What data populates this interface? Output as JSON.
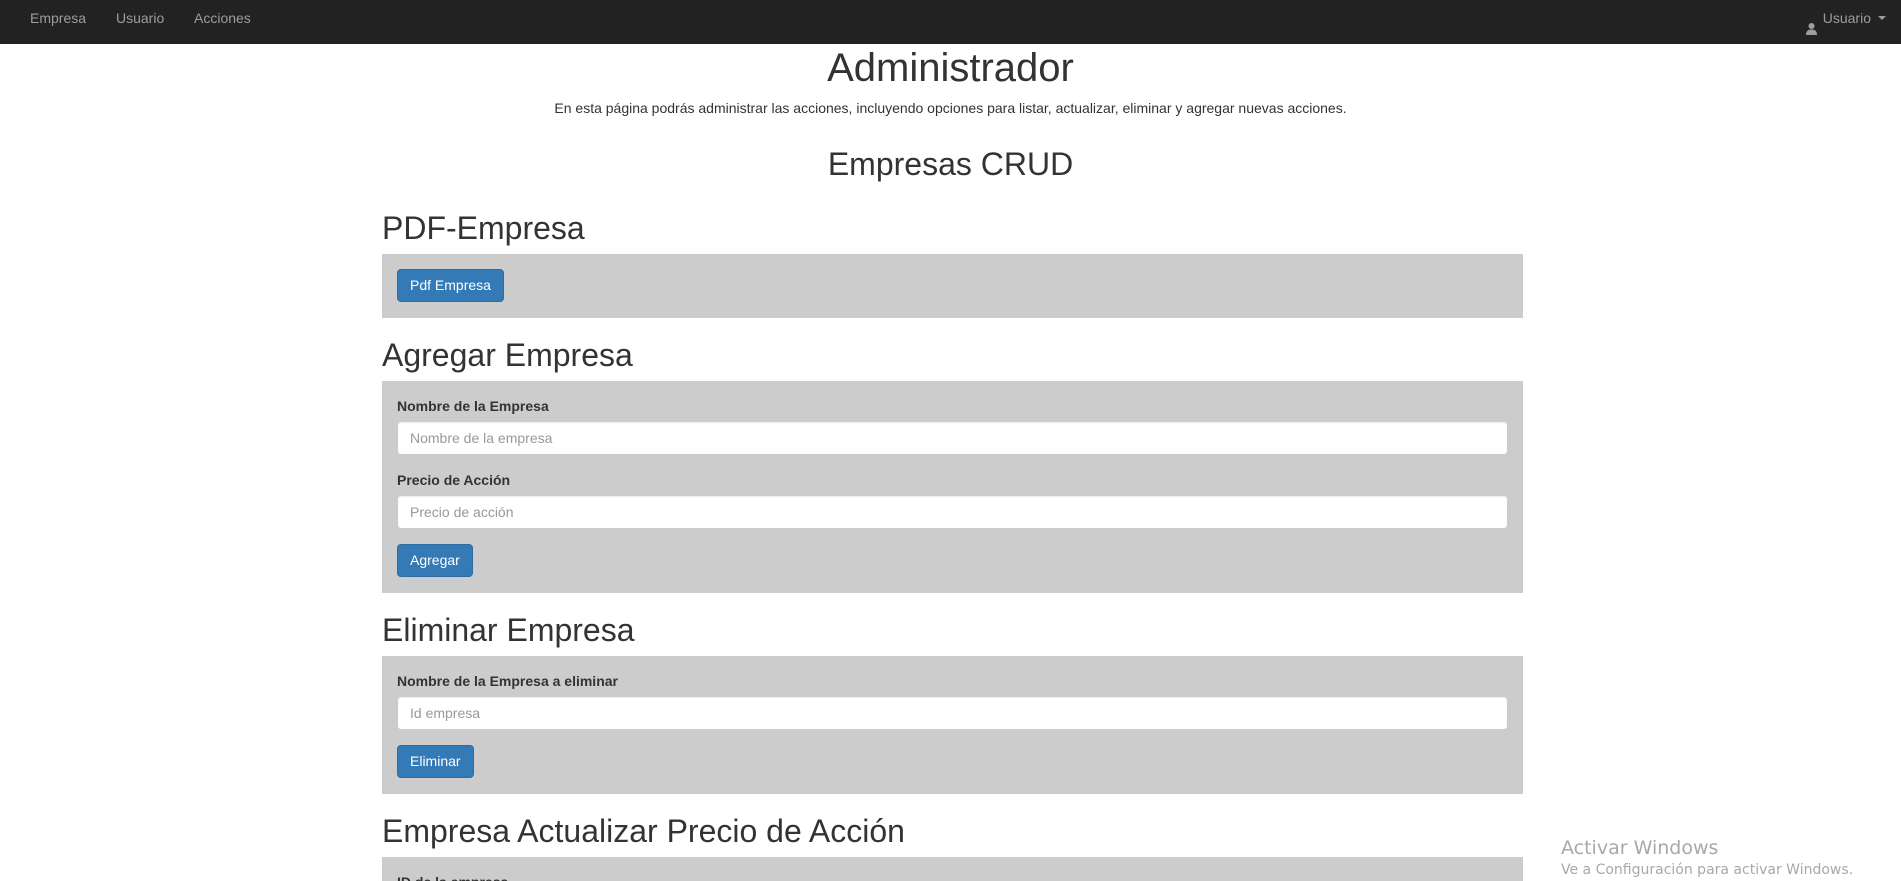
{
  "navbar": {
    "items": [
      {
        "label": "Empresa"
      },
      {
        "label": "Usuario"
      },
      {
        "label": "Acciones"
      }
    ],
    "user_label": "Usuario"
  },
  "header": {
    "title": "Administrador",
    "description": "En esta página podrás administrar las acciones, incluyendo opciones para listar, actualizar, eliminar y agregar nuevas acciones.",
    "crud_title": "Empresas CRUD"
  },
  "pdf_section": {
    "title": "PDF-Empresa",
    "button_label": "Pdf Empresa"
  },
  "add_section": {
    "title": "Agregar Empresa",
    "name_label": "Nombre de la Empresa",
    "name_placeholder": "Nombre de la empresa",
    "price_label": "Precio de Acción",
    "price_placeholder": "Precio de acción",
    "button_label": "Agregar"
  },
  "delete_section": {
    "title": "Eliminar Empresa",
    "name_label": "Nombre de la Empresa a eliminar",
    "id_placeholder": "Id empresa",
    "button_label": "Eliminar"
  },
  "update_section": {
    "title": "Empresa Actualizar Precio de Acción",
    "id_label": "ID de la empresa"
  },
  "windows_watermark": {
    "line1": "Activar Windows",
    "line2": "Ve a Configuración para activar Windows."
  },
  "colors": {
    "navbar_bg": "#222222",
    "panel_bg": "#cccccc",
    "primary_button": "#337ab7"
  }
}
